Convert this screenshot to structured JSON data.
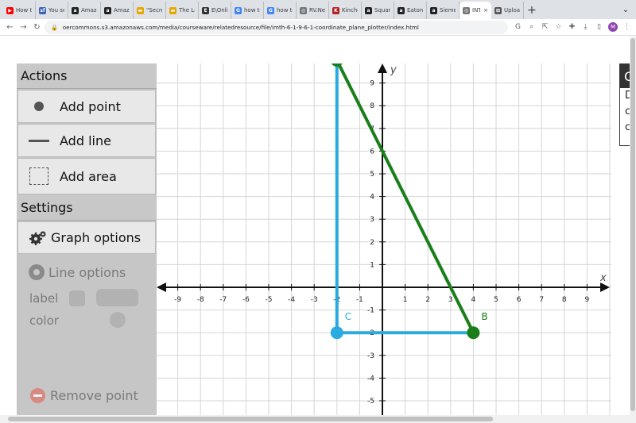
{
  "browser": {
    "tabs": [
      {
        "label": "How to",
        "fav": "youtube-icon",
        "color": "#ff0000",
        "glyph": "▶"
      },
      {
        "label": "You sea",
        "fav": "sf-icon",
        "color": "#3c64b4",
        "glyph": "sf"
      },
      {
        "label": "Amazo",
        "fav": "amazon-icon",
        "color": "#222222",
        "glyph": "a"
      },
      {
        "label": "Amazo",
        "fav": "amazon-icon",
        "color": "#222222",
        "glyph": "a"
      },
      {
        "label": "\"Secret",
        "fav": "bookmark-icon",
        "color": "#e8a600",
        "glyph": "▬"
      },
      {
        "label": "The La",
        "fav": "bookmark-icon",
        "color": "#e8a600",
        "glyph": "▬"
      },
      {
        "label": "E\\Onli",
        "fav": "e-icon",
        "color": "#333333",
        "glyph": "E"
      },
      {
        "label": "how to",
        "fav": "google-icon",
        "color": "#4285f4",
        "glyph": "G"
      },
      {
        "label": "how to",
        "fav": "google-icon",
        "color": "#4285f4",
        "glyph": "G"
      },
      {
        "label": "RV.Net",
        "fav": "globe-icon",
        "color": "#777777",
        "glyph": "◎"
      },
      {
        "label": "Kincho",
        "fav": "k-icon",
        "color": "#b22222",
        "glyph": "K"
      },
      {
        "label": "Square",
        "fav": "amazon-icon",
        "color": "#222222",
        "glyph": "a"
      },
      {
        "label": "Eaton I",
        "fav": "amazon-icon",
        "color": "#222222",
        "glyph": "a"
      },
      {
        "label": "Siemer",
        "fav": "amazon-icon",
        "color": "#222222",
        "glyph": "a"
      },
      {
        "label": "INT",
        "fav": "globe-icon",
        "color": "#777777",
        "glyph": "◎",
        "active": true
      },
      {
        "label": "Upload",
        "fav": "upload-icon",
        "color": "#555555",
        "glyph": "⊠"
      }
    ],
    "url": "oercommons.s3.amazonaws.com/media/courseware/relatedresource/file/imth-6-1-9-6-1-coordinate_plane_plotter/index.html",
    "avatar": "M"
  },
  "sidebar": {
    "actions_heading": "Actions",
    "add_point": "Add point",
    "add_line": "Add line",
    "add_area": "Add area",
    "settings_heading": "Settings",
    "graph_options": "Graph options",
    "line_options": "Line options",
    "label": "label",
    "color": "color",
    "remove_point": "Remove point"
  },
  "right_panel": {
    "heading": "C",
    "lines": [
      "D",
      "c",
      "c"
    ]
  },
  "graph": {
    "x_axis_label": "x",
    "y_axis_label": "y",
    "x_range": [
      -9,
      9
    ],
    "y_range": [
      -5,
      9
    ],
    "points": [
      {
        "label": "",
        "x": -2,
        "y": 10,
        "color": "#1a7f1a"
      },
      {
        "label": "B",
        "x": 4,
        "y": -2,
        "color": "#1a7f1a"
      },
      {
        "label": "C",
        "x": -2,
        "y": -2,
        "color": "#29abe2"
      }
    ],
    "segments": [
      {
        "from": [
          -2,
          10
        ],
        "to": [
          4,
          -2
        ],
        "color": "#1a7f1a"
      },
      {
        "from": [
          -2,
          10
        ],
        "to": [
          -2,
          -2
        ],
        "color": "#29abe2"
      },
      {
        "from": [
          -2,
          -2
        ],
        "to": [
          4,
          -2
        ],
        "color": "#29abe2"
      }
    ]
  }
}
